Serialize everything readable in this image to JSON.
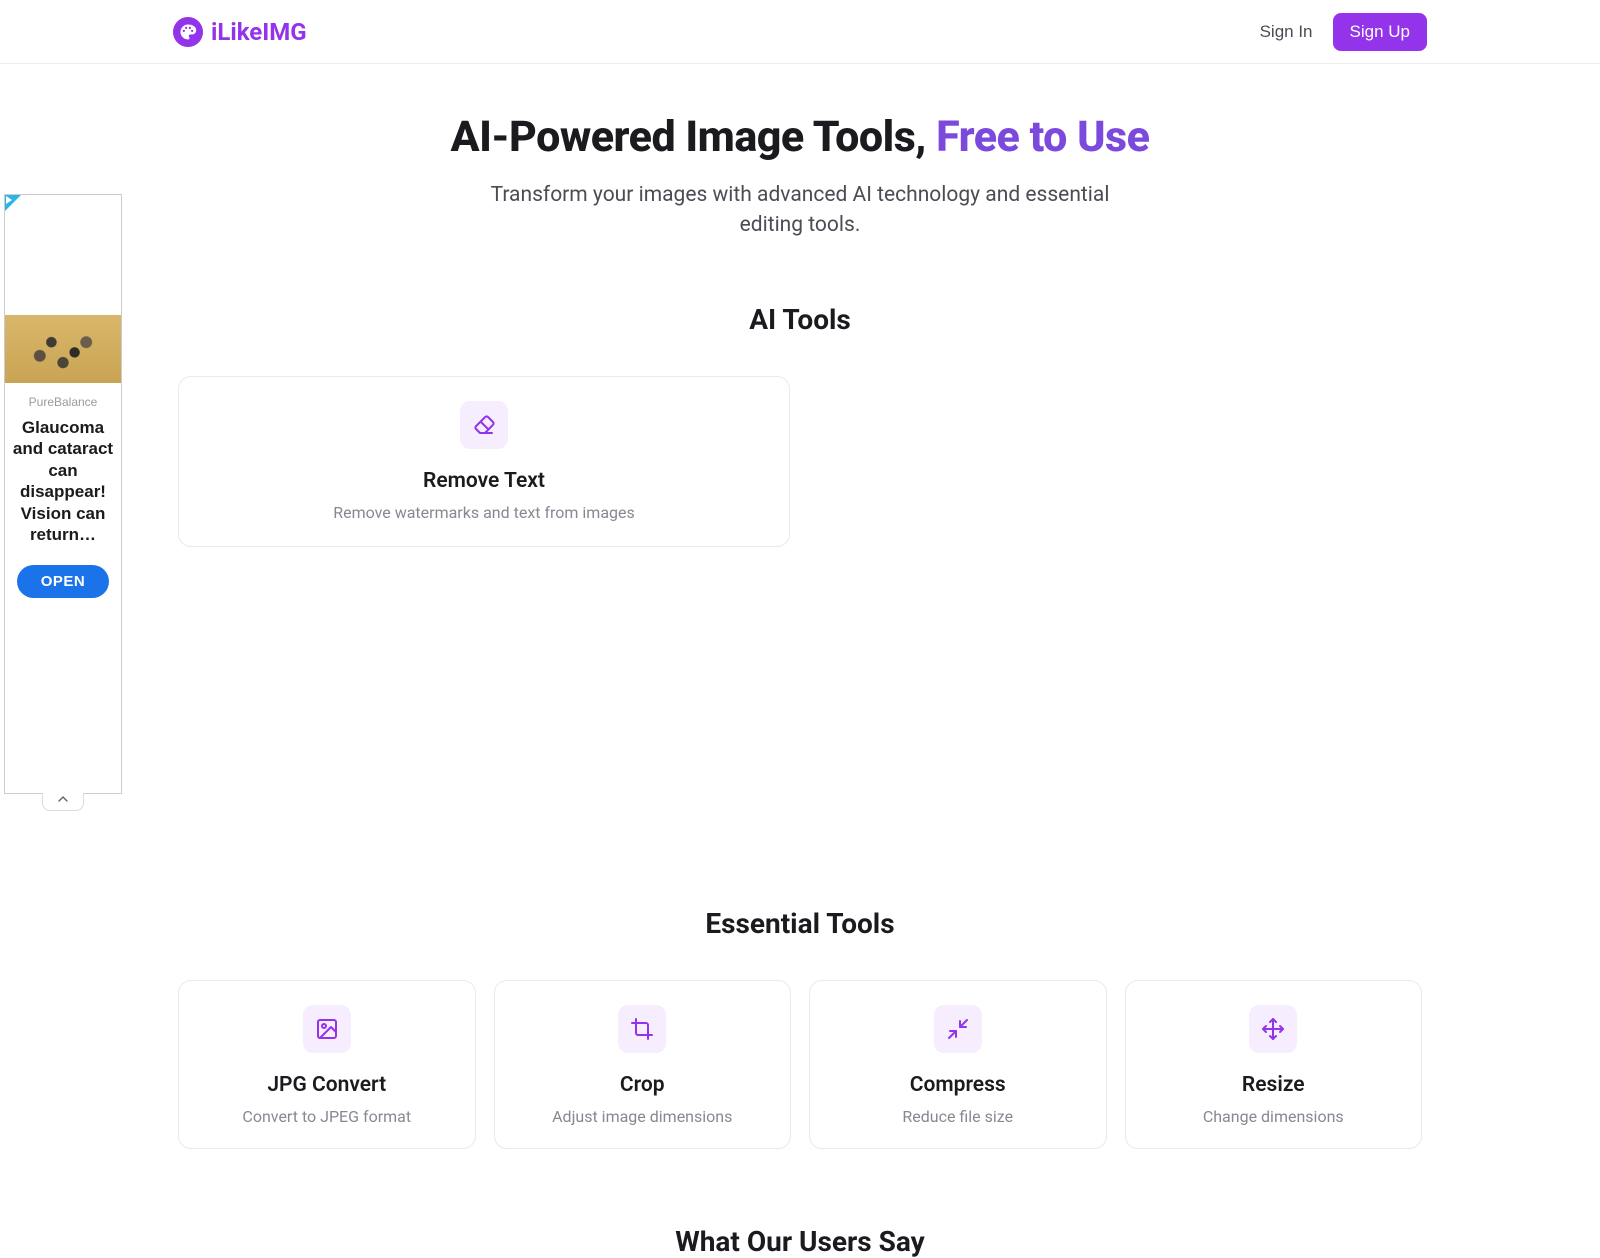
{
  "header": {
    "brand": "iLikeIMG",
    "signin_label": "Sign In",
    "signup_label": "Sign Up"
  },
  "hero": {
    "title_plain": "AI-Powered Image Tools, ",
    "title_accent": "Free to Use",
    "subtitle": "Transform your images with advanced AI technology and essential editing tools."
  },
  "sections": {
    "ai_tools_title": "AI Tools",
    "essential_tools_title": "Essential Tools",
    "users_say_title": "What Our Users Say"
  },
  "ai_tools": [
    {
      "icon": "eraser-icon",
      "title": "Remove Text",
      "desc": "Remove watermarks and text from images"
    }
  ],
  "essential_tools": [
    {
      "icon": "image-icon",
      "title": "JPG Convert",
      "desc": "Convert to JPEG format"
    },
    {
      "icon": "crop-icon",
      "title": "Crop",
      "desc": "Adjust image dimensions"
    },
    {
      "icon": "compress-icon",
      "title": "Compress",
      "desc": "Reduce file size"
    },
    {
      "icon": "move-icon",
      "title": "Resize",
      "desc": "Change dimensions"
    }
  ],
  "ad": {
    "brand": "PureBalance",
    "headline": "Glaucoma and cataract can disappear! Vision can return…",
    "cta": "OPEN"
  },
  "colors": {
    "primary": "#9333ea",
    "hero_accent": "#7b4adc",
    "icon_tile_bg": "#f6edff",
    "ad_button": "#1a73e8"
  }
}
